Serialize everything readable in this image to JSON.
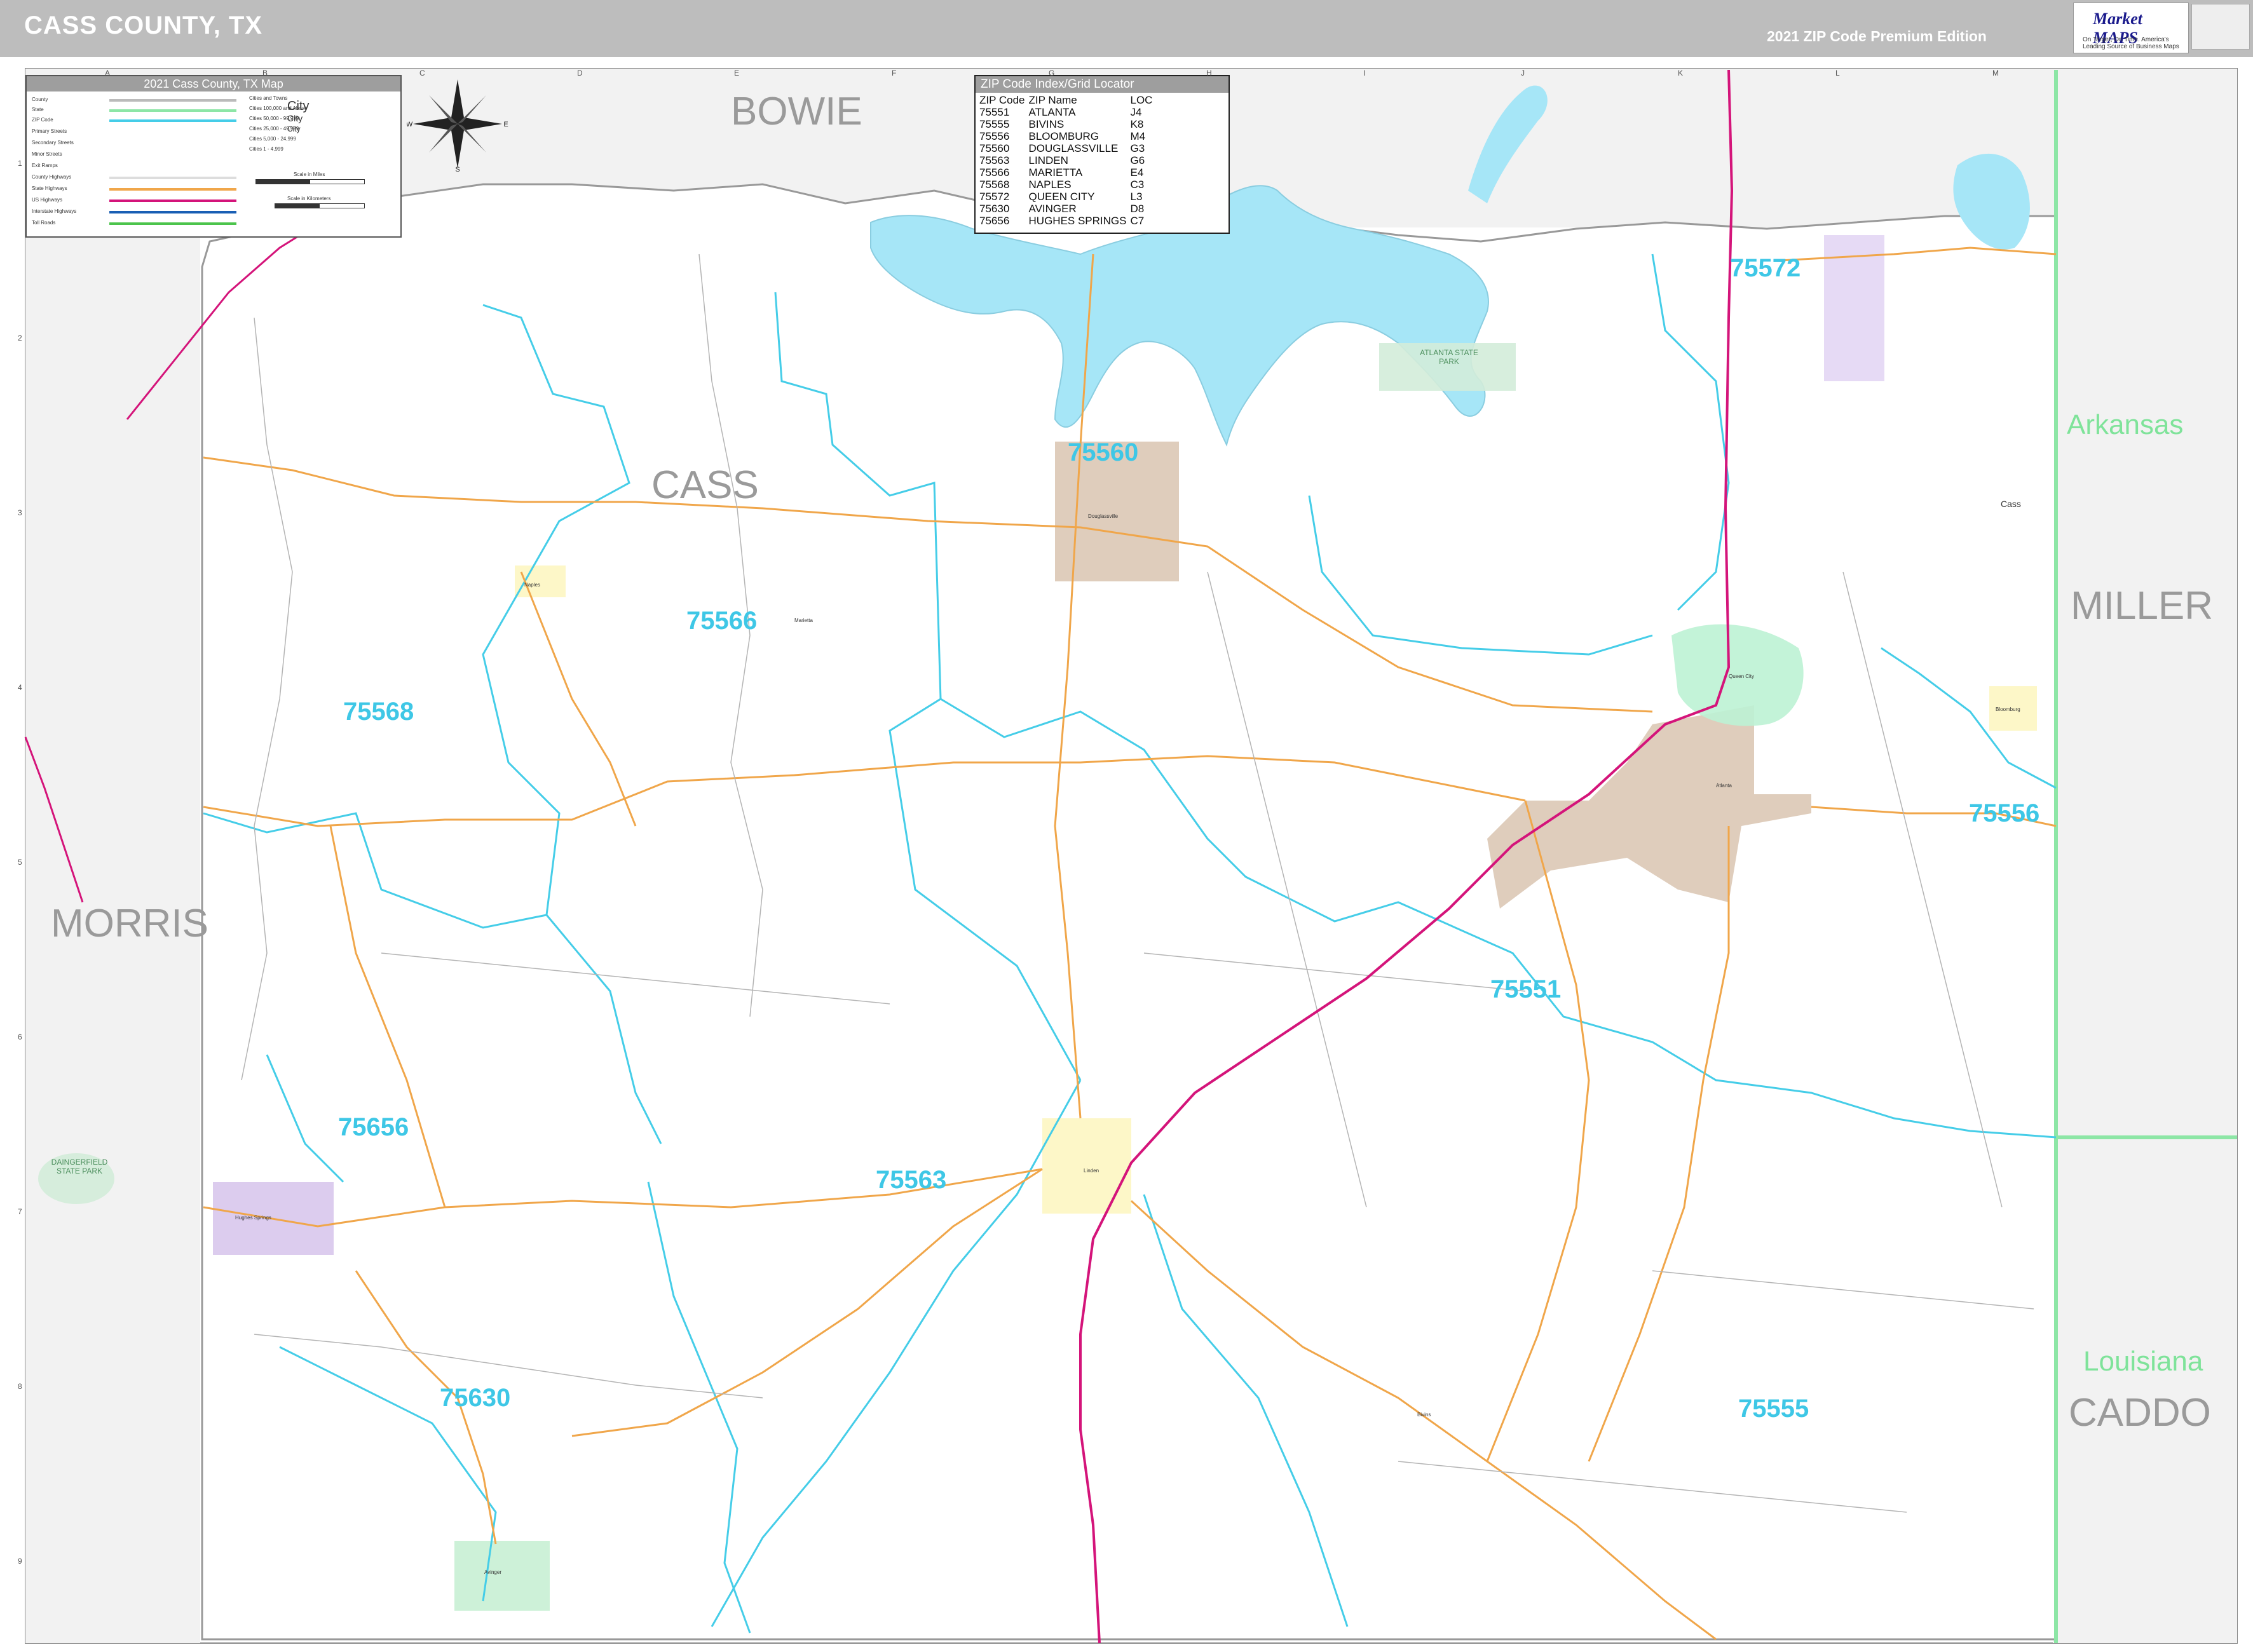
{
  "header": {
    "title": "CASS COUNTY, TX",
    "edition": "2021 ZIP Code Premium Edition",
    "logo_brand": "Market MAPS",
    "logo_tagline": "On Target, On Time. America's Leading Source of Business Maps"
  },
  "legend": {
    "title": "2021 Cass County, TX Map",
    "rows": [
      "County",
      "State",
      "ZIP Code",
      "Primary Streets",
      "Secondary Streets",
      "Minor Streets",
      "Exit Ramps",
      "County Highways",
      "State Highways",
      "US Highways",
      "Interstate Highways",
      "Toll Roads"
    ],
    "city_sizes": [
      "Cities and Towns",
      "Cities 100,000 and Above",
      "Cities 50,000 - 99,999",
      "Cities 25,000 - 49,999",
      "Cities 5,000 - 24,999",
      "Cities 1 - 4,999"
    ],
    "city_samples": [
      "City",
      "City",
      "City"
    ],
    "scale_miles": "Scale in Miles",
    "scale_km": "Scale in Kilometers"
  },
  "compass": {
    "n": "N",
    "s": "S",
    "e": "E",
    "w": "W"
  },
  "zip_index": {
    "title": "ZIP Code Index/Grid Locator",
    "headers": [
      "ZIP Code",
      "ZIP Name",
      "LOC"
    ],
    "rows": [
      [
        "75551",
        "ATLANTA",
        "J4"
      ],
      [
        "75555",
        "BIVINS",
        "K8"
      ],
      [
        "75556",
        "BLOOMBURG",
        "M4"
      ],
      [
        "75560",
        "DOUGLASSVILLE",
        "G3"
      ],
      [
        "75563",
        "LINDEN",
        "G6"
      ],
      [
        "75566",
        "MARIETTA",
        "E4"
      ],
      [
        "75568",
        "NAPLES",
        "C3"
      ],
      [
        "75572",
        "QUEEN CITY",
        "L3"
      ],
      [
        "75630",
        "AVINGER",
        "D8"
      ],
      [
        "75656",
        "HUGHES SPRINGS",
        "C7"
      ]
    ]
  },
  "counties": {
    "bowie": "BOWIE",
    "cass": "CASS",
    "morris": "MORRIS",
    "miller": "MILLER",
    "caddo": "CADDO"
  },
  "states": {
    "arkansas": "Arkansas",
    "louisiana": "Louisiana"
  },
  "zip_labels": {
    "z75560": "75560",
    "z75566": "75566",
    "z75568": "75568",
    "z75572": "75572",
    "z75556": "75556",
    "z75551": "75551",
    "z75656": "75656",
    "z75563": "75563",
    "z75630": "75630",
    "z75555": "75555"
  },
  "parks": {
    "atlanta": "ATLANTA STATE PARK",
    "daingerfield": "DAINGERFIELD STATE PARK"
  },
  "grid": {
    "letters": [
      "A",
      "B",
      "C",
      "D",
      "E",
      "F",
      "G",
      "H",
      "I",
      "J",
      "K",
      "L",
      "M"
    ],
    "numbers": [
      "1",
      "2",
      "3",
      "4",
      "5",
      "6",
      "7",
      "8",
      "9"
    ]
  },
  "towns": {
    "cass": "Cass",
    "bloomburg": "Bloomburg",
    "linden": "Linden",
    "atlanta": "Atlanta",
    "queen_city": "Queen City",
    "douglassville": "Douglassville",
    "marietta": "Marietta",
    "naples": "Naples",
    "hughes_springs": "Hughes Springs",
    "avinger": "Avinger",
    "bivins": "Bivins"
  },
  "colors": {
    "water": "#a6e6f7",
    "zip_boundary": "#45cde8",
    "road_state": "#f0a64a",
    "us_highway": "#d4147a",
    "outside_county": "#f2f2f2",
    "state_line": "#8de6a6"
  }
}
